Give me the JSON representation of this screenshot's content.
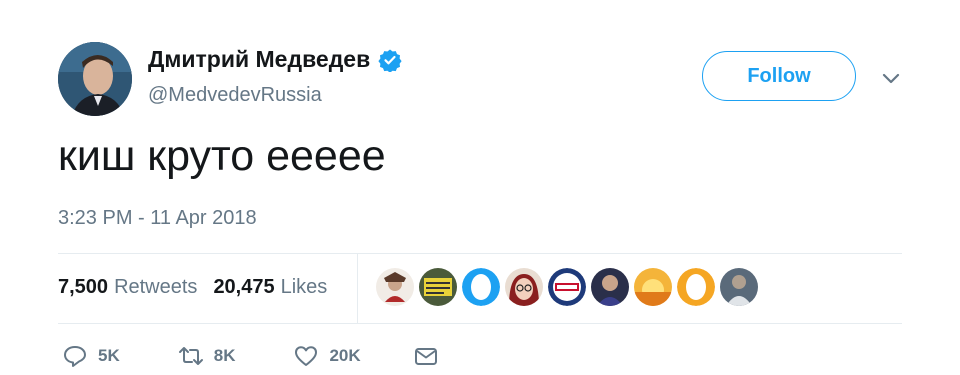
{
  "user": {
    "name": "Дмитрий Медведев",
    "handle": "@MedvedevRussia",
    "verified": true,
    "avatar_icon": "profile-photo"
  },
  "follow_label": "Follow",
  "tweet": {
    "text": "киш круто еееее",
    "timestamp": "3:23 PM - 11 Apr 2018"
  },
  "stats": {
    "retweets_count": "7,500",
    "retweets_label": "Retweets",
    "likes_count": "20,475",
    "likes_label": "Likes"
  },
  "likers": [
    {
      "icon": "liker-avatar-1"
    },
    {
      "icon": "liker-avatar-2"
    },
    {
      "icon": "liker-avatar-3"
    },
    {
      "icon": "liker-avatar-4"
    },
    {
      "icon": "liker-avatar-5"
    },
    {
      "icon": "liker-avatar-6"
    },
    {
      "icon": "liker-avatar-7"
    },
    {
      "icon": "liker-avatar-8"
    },
    {
      "icon": "liker-avatar-9"
    }
  ],
  "actions": {
    "reply_count": "5K",
    "retweet_count": "8K",
    "like_count": "20K"
  },
  "colors": {
    "accent": "#1da1f2",
    "text": "#14171a",
    "secondary": "#657786",
    "divider": "#e6ecf0"
  }
}
